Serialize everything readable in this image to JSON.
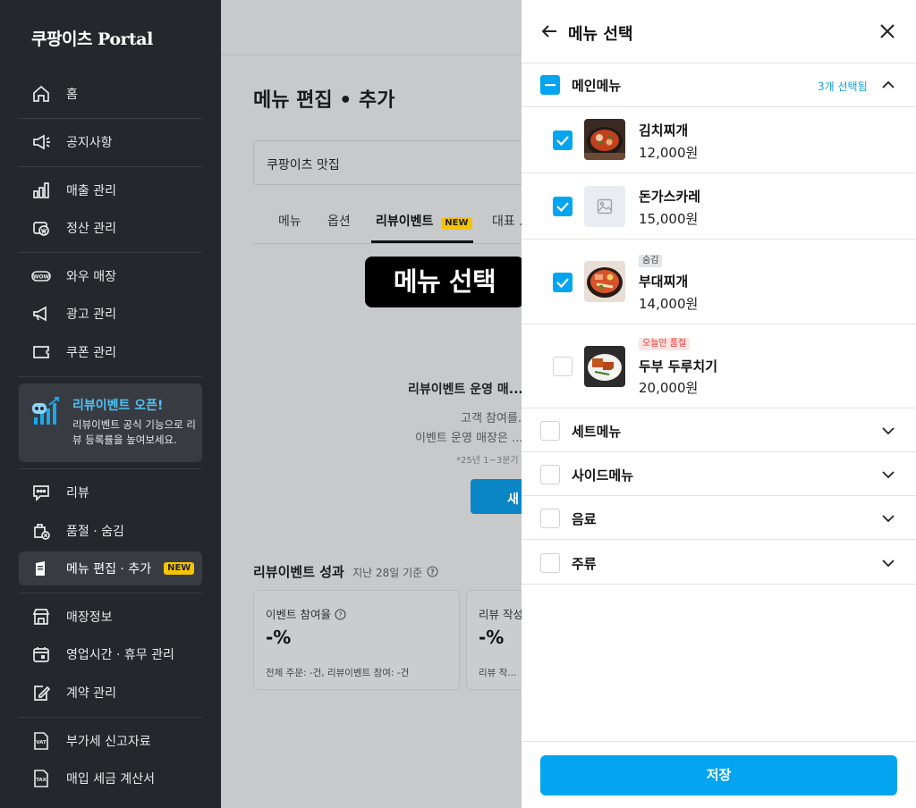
{
  "sidebar": {
    "brand_main": "쿠팡이츠",
    "brand_portal": "Portal",
    "items": [
      {
        "label": "홈"
      },
      {
        "label": "공지사항"
      },
      {
        "label": "매출 관리"
      },
      {
        "label": "정산 관리"
      },
      {
        "label": "와우 매장"
      },
      {
        "label": "광고 관리"
      },
      {
        "label": "쿠폰 관리"
      },
      {
        "label": "리뷰"
      },
      {
        "label": "품절 · 숨김"
      },
      {
        "label": "메뉴 편집 · 추가",
        "badge": "NEW"
      },
      {
        "label": "매장정보"
      },
      {
        "label": "영업시간 · 휴무 관리"
      },
      {
        "label": "계약 관리"
      },
      {
        "label": "부가세 신고자료"
      },
      {
        "label": "매입 세금 계산서"
      }
    ],
    "promo": {
      "title": "리뷰이벤트 오픈!",
      "desc": "리뷰이벤트 공식 기능으로 리뷰 등록률을 높여보세요."
    }
  },
  "main": {
    "page_title": "메뉴 편집 • 추가",
    "store_name": "쿠팡이츠 맛집",
    "tabs": [
      {
        "label": "메뉴"
      },
      {
        "label": "옵션"
      },
      {
        "label": "리뷰이벤트",
        "badge": "NEW"
      },
      {
        "label": "대표 ..."
      }
    ],
    "center_title": "리뷰이벤트 운영 매...",
    "center_line1": "고객 참여를...",
    "center_line2": "이벤트 운영 매장은 ...",
    "center_note": "*25년 1~3분기 ...",
    "center_button": "새",
    "perf_title": "리뷰이벤트 성과",
    "perf_sub": "지난 28일 기준",
    "cards": [
      {
        "label": "이벤트 참여율",
        "value": "-%",
        "foot": "전체 주문: -건, 리뷰이벤트 참여: -건"
      },
      {
        "label": "리뷰 작성...",
        "value": "-%",
        "foot": "리뷰 작..."
      }
    ]
  },
  "tooltip": "메뉴 선택",
  "panel": {
    "title": "메뉴 선택",
    "groups": [
      {
        "label": "메인메뉴",
        "count": "3개 선택됨",
        "expanded": true
      },
      {
        "label": "세트메뉴"
      },
      {
        "label": "사이드메뉴"
      },
      {
        "label": "음료"
      },
      {
        "label": "주류"
      }
    ],
    "items": [
      {
        "name": "김치찌개",
        "price": "12,000원",
        "checked": true
      },
      {
        "name": "돈가스카레",
        "price": "15,000원",
        "checked": true
      },
      {
        "name": "부대찌개",
        "price": "14,000원",
        "checked": true,
        "tag": "숨김"
      },
      {
        "name": "두부 두루치기",
        "price": "20,000원",
        "checked": false,
        "tag": "오늘만 품절"
      }
    ],
    "save_label": "저장"
  },
  "colors": {
    "accent": "#03a5f0",
    "sidebar_bg": "#24272c",
    "new_badge": "#f5c400",
    "soldout_text": "#e5362f"
  }
}
